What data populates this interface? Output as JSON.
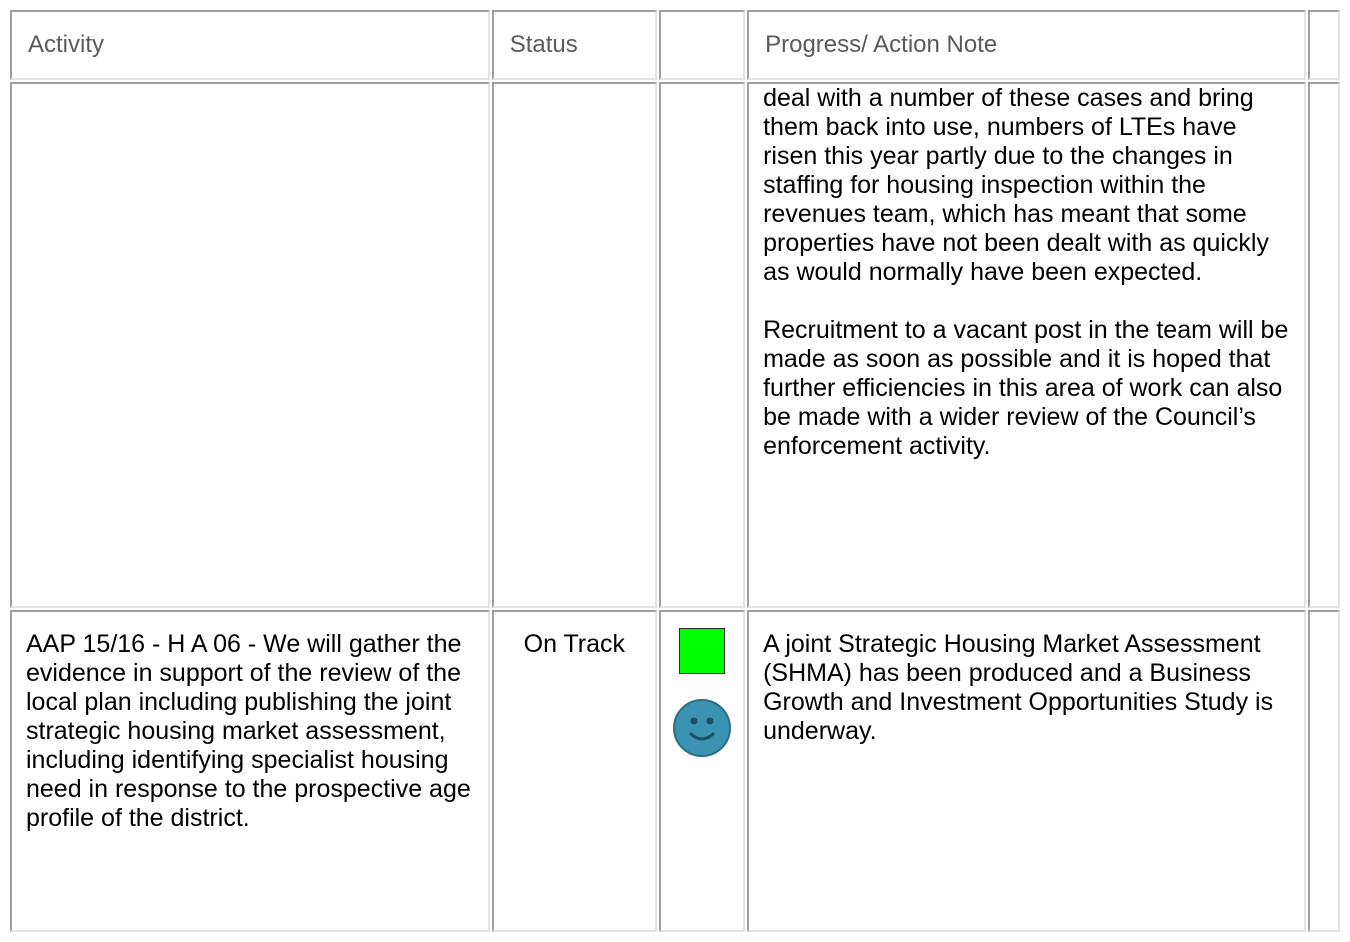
{
  "table": {
    "headers": {
      "activity": "Activity",
      "status": "Status",
      "indicator": "",
      "progress": "Progress/ Action Note",
      "extra": ""
    },
    "rows": [
      {
        "activity": "",
        "status": "",
        "progress": {
          "paragraphs": [
            "deal with a number of these cases and bring them back into use, numbers of LTEs have risen this year partly due to the changes in staffing for housing inspection within the revenues team, which has meant that some properties have not been dealt with as quickly as would normally have been expected.",
            "Recruitment to a vacant post in the team will be made as soon as possible and it is hoped that further efficiencies in this area of work can also be made with a wider review of the Council’s enforcement activity."
          ]
        }
      },
      {
        "activity": "AAP 15/16 - H A 06 - We will gather the evidence in support of the review of the local plan including publishing the joint strategic housing market assessment, including identifying specialist housing need in response to the prospective age profile of the district.",
        "status": "On Track",
        "indicator": {
          "status_square_icon": "green-square-icon",
          "status_square_color": "#00ff00",
          "face_icon": "smiley-face-icon",
          "face_color": "#3a93b3"
        },
        "progress": {
          "paragraphs": [
            "A joint Strategic Housing Market Assessment (SHMA) has been produced and a Business Growth and Investment Opportunities Study is underway."
          ]
        }
      }
    ]
  }
}
